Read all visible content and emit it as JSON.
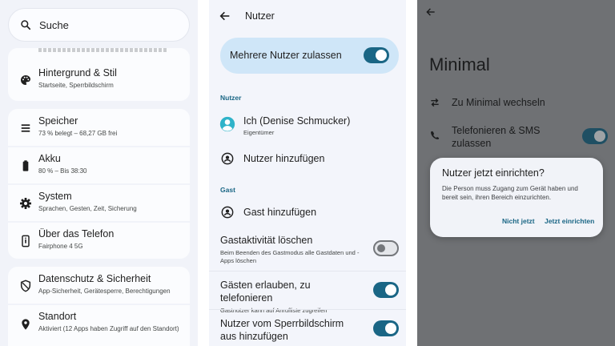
{
  "panel_settings": {
    "search": {
      "label": "Suche"
    },
    "items": [
      {
        "title": "Hintergrund & Stil",
        "subtitle": "Startseite, Sperrbildschirm",
        "icon": "palette-icon"
      },
      {
        "title": "Speicher",
        "subtitle": "73 % belegt – 68,27 GB frei",
        "icon": "storage-icon"
      },
      {
        "title": "Akku",
        "subtitle": "80 % – Bis 38:30",
        "icon": "battery-icon"
      },
      {
        "title": "System",
        "subtitle": "Sprachen, Gesten, Zeit, Sicherung",
        "icon": "gear-icon"
      },
      {
        "title": "Über das Telefon",
        "subtitle": "Fairphone 4 5G",
        "icon": "phone-icon"
      },
      {
        "title": "Datenschutz & Sicherheit",
        "subtitle": "App-Sicherheit, Gerätesperre, Berechtigungen",
        "icon": "shield-icon"
      },
      {
        "title": "Standort",
        "subtitle": "Aktiviert (12 Apps haben Zugriff auf den Standort)",
        "icon": "location-icon"
      }
    ]
  },
  "panel_users": {
    "title": "Nutzer",
    "allow_multiple": {
      "label": "Mehrere Nutzer zulassen",
      "on": true
    },
    "section_users": "Nutzer",
    "owner": {
      "name": "Ich (Denise Schmucker)",
      "role": "Eigentümer"
    },
    "add_user": "Nutzer hinzufügen",
    "section_guest": "Gast",
    "add_guest": "Gast hinzufügen",
    "clear_guest": {
      "title": "Gastaktivität löschen",
      "subtitle": "Beim Beenden des Gastmodus alle Gastdaten und -Apps löschen",
      "on": false
    },
    "guest_calls": {
      "title": "Gästen erlauben, zu telefonieren",
      "subtitle": "Gastnutzer kann auf Anrufliste zugreifen",
      "on": true
    },
    "lock_add": {
      "title": "Nutzer vom Sperrbildschirm aus hinzufügen",
      "on": true
    }
  },
  "panel_minimal": {
    "title": "Minimal",
    "switch_label": "Zu Minimal wechseln",
    "calls_label": "Telefonieren & SMS zulassen",
    "dialog": {
      "title": "Nutzer jetzt einrichten?",
      "body": "Die Person muss Zugang zum Gerät haben und bereit sein, ihren Bereich einzurichten.",
      "cancel": "Nicht jetzt",
      "confirm": "Jetzt einrichten"
    }
  },
  "colors": {
    "accent": "#1a6685",
    "toggle_card": "#cfe6f8",
    "scrim": "#6f7174"
  }
}
